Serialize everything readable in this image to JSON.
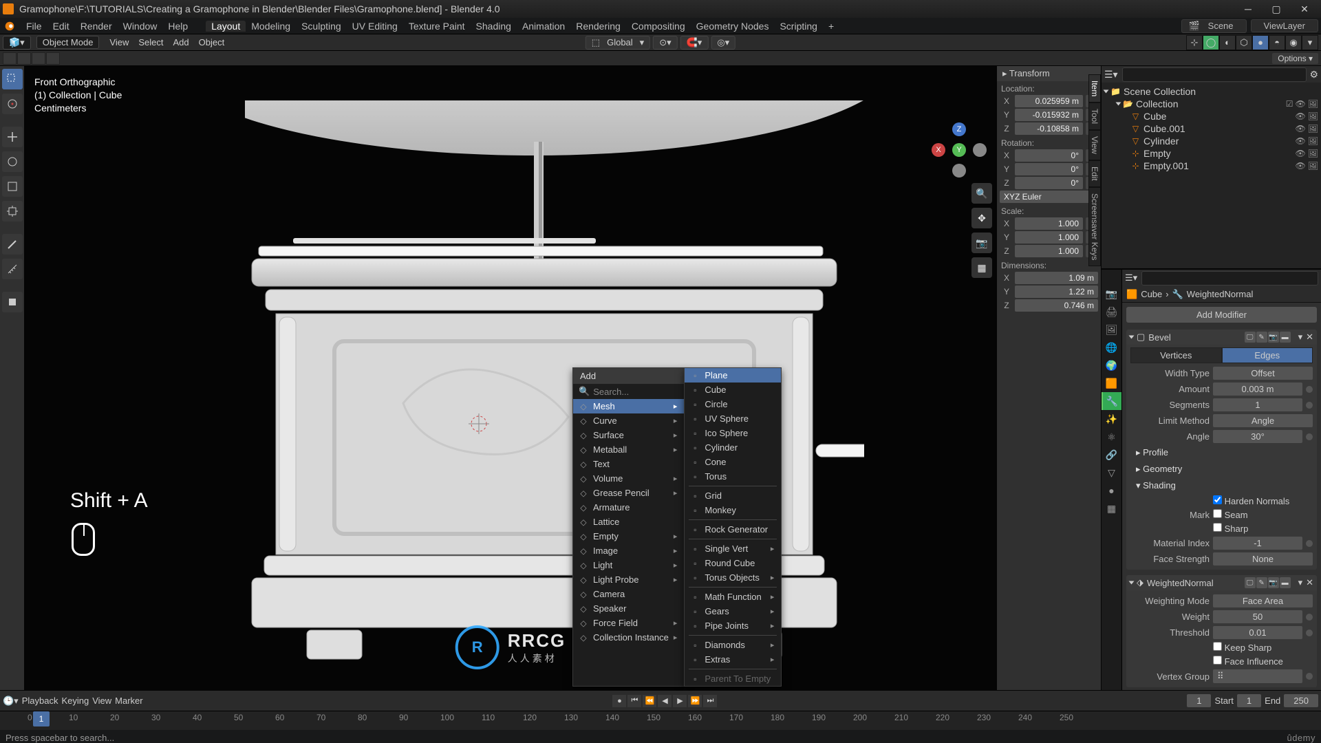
{
  "title": "Gramophone\\F:\\TUTORIALS\\Creating a Gramophone in Blender\\Blender Files\\Gramophone.blend] - Blender 4.0",
  "menus": {
    "file": "File",
    "edit": "Edit",
    "render": "Render",
    "window": "Window",
    "help": "Help"
  },
  "workspaces": [
    "Layout",
    "Modeling",
    "Sculpting",
    "UV Editing",
    "Texture Paint",
    "Shading",
    "Animation",
    "Rendering",
    "Compositing",
    "Geometry Nodes",
    "Scripting",
    "+"
  ],
  "top_right": {
    "scene": "Scene",
    "viewlayer": "ViewLayer"
  },
  "submenu": {
    "mode": "Object Mode",
    "items": [
      "View",
      "Select",
      "Add",
      "Object"
    ],
    "global": "Global"
  },
  "viewport_info": {
    "l1": "Front Orthographic",
    "l2": "(1) Collection | Cube",
    "l3": "Centimeters"
  },
  "overlay_key": "Shift + A",
  "add_menu": {
    "title": "Add",
    "search": "Search...",
    "items": [
      {
        "label": "Mesh",
        "sub": true,
        "hl": true
      },
      {
        "label": "Curve",
        "sub": true
      },
      {
        "label": "Surface",
        "sub": true
      },
      {
        "label": "Metaball",
        "sub": true
      },
      {
        "label": "Text"
      },
      {
        "label": "Volume",
        "sub": true
      },
      {
        "label": "Grease Pencil",
        "sub": true
      },
      {
        "label": "Armature"
      },
      {
        "label": "Lattice"
      },
      {
        "label": "Empty",
        "sub": true
      },
      {
        "label": "Image",
        "sub": true
      },
      {
        "label": "Light",
        "sub": true
      },
      {
        "label": "Light Probe",
        "sub": true
      },
      {
        "label": "Camera"
      },
      {
        "label": "Speaker"
      },
      {
        "label": "Force Field",
        "sub": true
      },
      {
        "label": "Collection Instance",
        "sub": true
      }
    ],
    "mesh": [
      {
        "label": "Plane",
        "hl": true
      },
      {
        "label": "Cube"
      },
      {
        "label": "Circle"
      },
      {
        "label": "UV Sphere"
      },
      {
        "label": "Ico Sphere"
      },
      {
        "label": "Cylinder"
      },
      {
        "label": "Cone"
      },
      {
        "label": "Torus"
      },
      {
        "sep": true
      },
      {
        "label": "Grid"
      },
      {
        "label": "Monkey"
      },
      {
        "sep": true
      },
      {
        "label": "Rock Generator"
      },
      {
        "sep": true
      },
      {
        "label": "Single Vert",
        "sub": true
      },
      {
        "label": "Round Cube"
      },
      {
        "label": "Torus Objects",
        "sub": true
      },
      {
        "sep": true
      },
      {
        "label": "Math Function",
        "sub": true
      },
      {
        "label": "Gears",
        "sub": true
      },
      {
        "label": "Pipe Joints",
        "sub": true
      },
      {
        "sep": true
      },
      {
        "label": "Diamonds",
        "sub": true
      },
      {
        "label": "Extras",
        "sub": true
      },
      {
        "sep": true
      },
      {
        "label": "Parent To Empty",
        "disabled": true
      }
    ]
  },
  "npanel": {
    "title": "Transform",
    "location": "Location:",
    "loc": {
      "x": "0.025959 m",
      "y": "-0.015932 m",
      "z": "-0.10858 m"
    },
    "rotation": "Rotation:",
    "rot": {
      "x": "0°",
      "y": "0°",
      "z": "0°"
    },
    "rotmode": "XYZ Euler",
    "scale": "Scale:",
    "sca": {
      "x": "1.000",
      "y": "1.000",
      "z": "1.000"
    },
    "dimensions": "Dimensions:",
    "dim": {
      "x": "1.09 m",
      "y": "1.22 m",
      "z": "0.746 m"
    },
    "tabs": [
      "Item",
      "Tool",
      "View",
      "Edit",
      "Screensaver Keys"
    ]
  },
  "outliner": {
    "header": "Scene Collection",
    "items": [
      {
        "name": "Collection",
        "type": "collection"
      },
      {
        "name": "Cube",
        "type": "mesh",
        "indent": 2
      },
      {
        "name": "Cube.001",
        "type": "mesh",
        "indent": 2
      },
      {
        "name": "Cylinder",
        "type": "mesh",
        "indent": 2
      },
      {
        "name": "Empty",
        "type": "empty",
        "indent": 2
      },
      {
        "name": "Empty.001",
        "type": "empty",
        "indent": 2
      }
    ]
  },
  "props": {
    "crumb_obj": "Cube",
    "crumb_mod": "WeightedNormal",
    "addmod": "Add Modifier",
    "bevel": {
      "name": "Bevel",
      "seg_a": "Vertices",
      "seg_b": "Edges",
      "width_type_l": "Width Type",
      "width_type_v": "Offset",
      "amount_l": "Amount",
      "amount_v": "0.003 m",
      "segments_l": "Segments",
      "segments_v": "1",
      "limit_l": "Limit Method",
      "limit_v": "Angle",
      "angle_l": "Angle",
      "angle_v": "30°",
      "subs": [
        "Profile",
        "Geometry",
        "Shading"
      ],
      "harden": "Harden Normals",
      "mark_l": "Mark",
      "mark_a": "Seam",
      "mark_b": "Sharp",
      "matidx_l": "Material Index",
      "matidx_v": "-1",
      "face_l": "Face Strength",
      "face_v": "None"
    },
    "wn": {
      "name": "WeightedNormal",
      "mode_l": "Weighting Mode",
      "mode_v": "Face Area",
      "weight_l": "Weight",
      "weight_v": "50",
      "thresh_l": "Threshold",
      "thresh_v": "0.01",
      "keep": "Keep Sharp",
      "face": "Face Influence",
      "vg_l": "Vertex Group"
    }
  },
  "timeline": {
    "playback": "Playback",
    "keying": "Keying",
    "view": "View",
    "marker": "Marker",
    "frame": "1",
    "start_l": "Start",
    "start_v": "1",
    "end_l": "End",
    "end_v": "250",
    "ticks": [
      "0",
      "10",
      "20",
      "30",
      "40",
      "50",
      "60",
      "70",
      "80",
      "90",
      "100",
      "110",
      "120",
      "130",
      "140",
      "150",
      "160",
      "170",
      "180",
      "190",
      "200",
      "210",
      "220",
      "230",
      "240",
      "250"
    ]
  },
  "status": {
    "left": "Press spacebar to search...",
    "udemy": "ûdemy"
  },
  "watermark": {
    "big": "RRCG",
    "sub": "人人素材"
  }
}
